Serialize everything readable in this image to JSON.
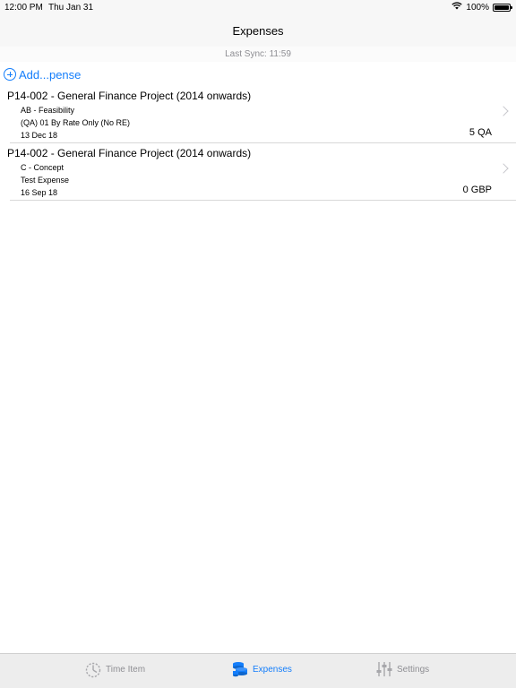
{
  "status": {
    "time": "12:00 PM",
    "date": "Thu Jan 31",
    "battery": "100%",
    "battery_level": 1.0
  },
  "nav": {
    "title": "Expenses"
  },
  "sync": {
    "text": "Last Sync: 11:59"
  },
  "add": {
    "label": "Add...pense"
  },
  "expenses": [
    {
      "title": "P14-002 - General Finance Project (2014 onwards)",
      "line1": "AB - Feasibility",
      "line2": "(QA) 01 By Rate Only (No RE)",
      "date": "13 Dec 18",
      "amount": "5 QA"
    },
    {
      "title": "P14-002 - General Finance Project (2014 onwards)",
      "line1": "C - Concept",
      "line2": "Test Expense",
      "date": "16 Sep 18",
      "amount": "0 GBP"
    }
  ],
  "tabs": [
    {
      "label": "Time Item",
      "icon": "timer-icon"
    },
    {
      "label": "Expenses",
      "icon": "coins-icon"
    },
    {
      "label": "Settings",
      "icon": "sliders-icon"
    }
  ],
  "colors": {
    "accent": "#147efb",
    "inactive": "#8e8e93"
  }
}
